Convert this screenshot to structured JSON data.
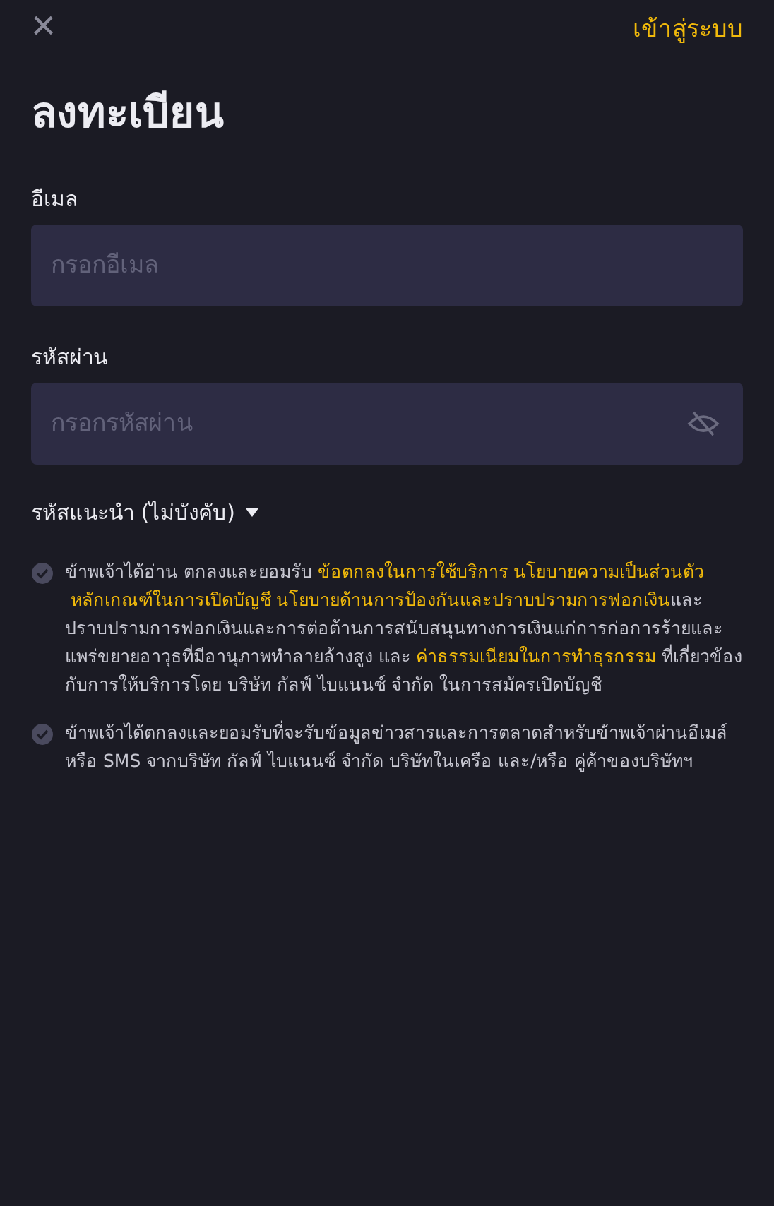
{
  "header": {
    "close": "×",
    "login_link": "เข้าสู่ระบบ"
  },
  "title": "ลงทะเบียน",
  "email": {
    "label": "อีเมล",
    "placeholder": "กรอกอีเมล"
  },
  "password": {
    "label": "รหัสผ่าน",
    "placeholder": "กรอกรหัสผ่าน"
  },
  "referral": {
    "label": "รหัสแนะนำ (ไม่บังคับ)",
    "expanded": false
  },
  "consents": [
    {
      "checked": false,
      "segments": [
        {
          "kind": "text",
          "text": "ข้าพเจ้าได้อ่าน ตกลงและยอมรับ "
        },
        {
          "kind": "link",
          "text": "ข้อตกลงในการใช้บริการ"
        },
        {
          "kind": "link",
          "text": "นโยบายความเป็นส่วนตัว"
        },
        {
          "kind": "link",
          "text": "หลักเกณฑ์ในการเปิดบัญชี"
        },
        {
          "kind": "link",
          "text": "นโยบายด้านการป้องกันและปราบปรามการฟอกเงิน"
        },
        {
          "kind": "text",
          "text": "และปราบปรามการฟอกเงินและการต่อต้านการสนับสนุนทางการเงินแก่การก่อการร้ายและแพร่ขยายอาวุธที่มีอานุภาพทำลายล้างสูง และ"
        },
        {
          "kind": "link",
          "text": "ค่าธรรมเนียมในการทำธุรกรรม"
        },
        {
          "kind": "text",
          "text": " ที่เกี่ยวข้องกับการให้บริการโดย บริษัท กัลฟ์ ไบแนนซ์ จำกัด ในการสมัครเปิดบัญชี"
        }
      ]
    },
    {
      "checked": false,
      "segments": [
        {
          "kind": "text",
          "text": "ข้าพเจ้าได้ตกลงและยอมรับที่จะรับข้อมูลข่าวสารและการตลาดสำหรับข้าพเจ้าผ่านอีเมล์ หรือ SMS จากบริษัท กัลฟ์ ไบแนนซ์ จำกัด บริษัทในเครือ และ/หรือ คู่ค้าของบริษัทฯ"
        }
      ]
    }
  ]
}
